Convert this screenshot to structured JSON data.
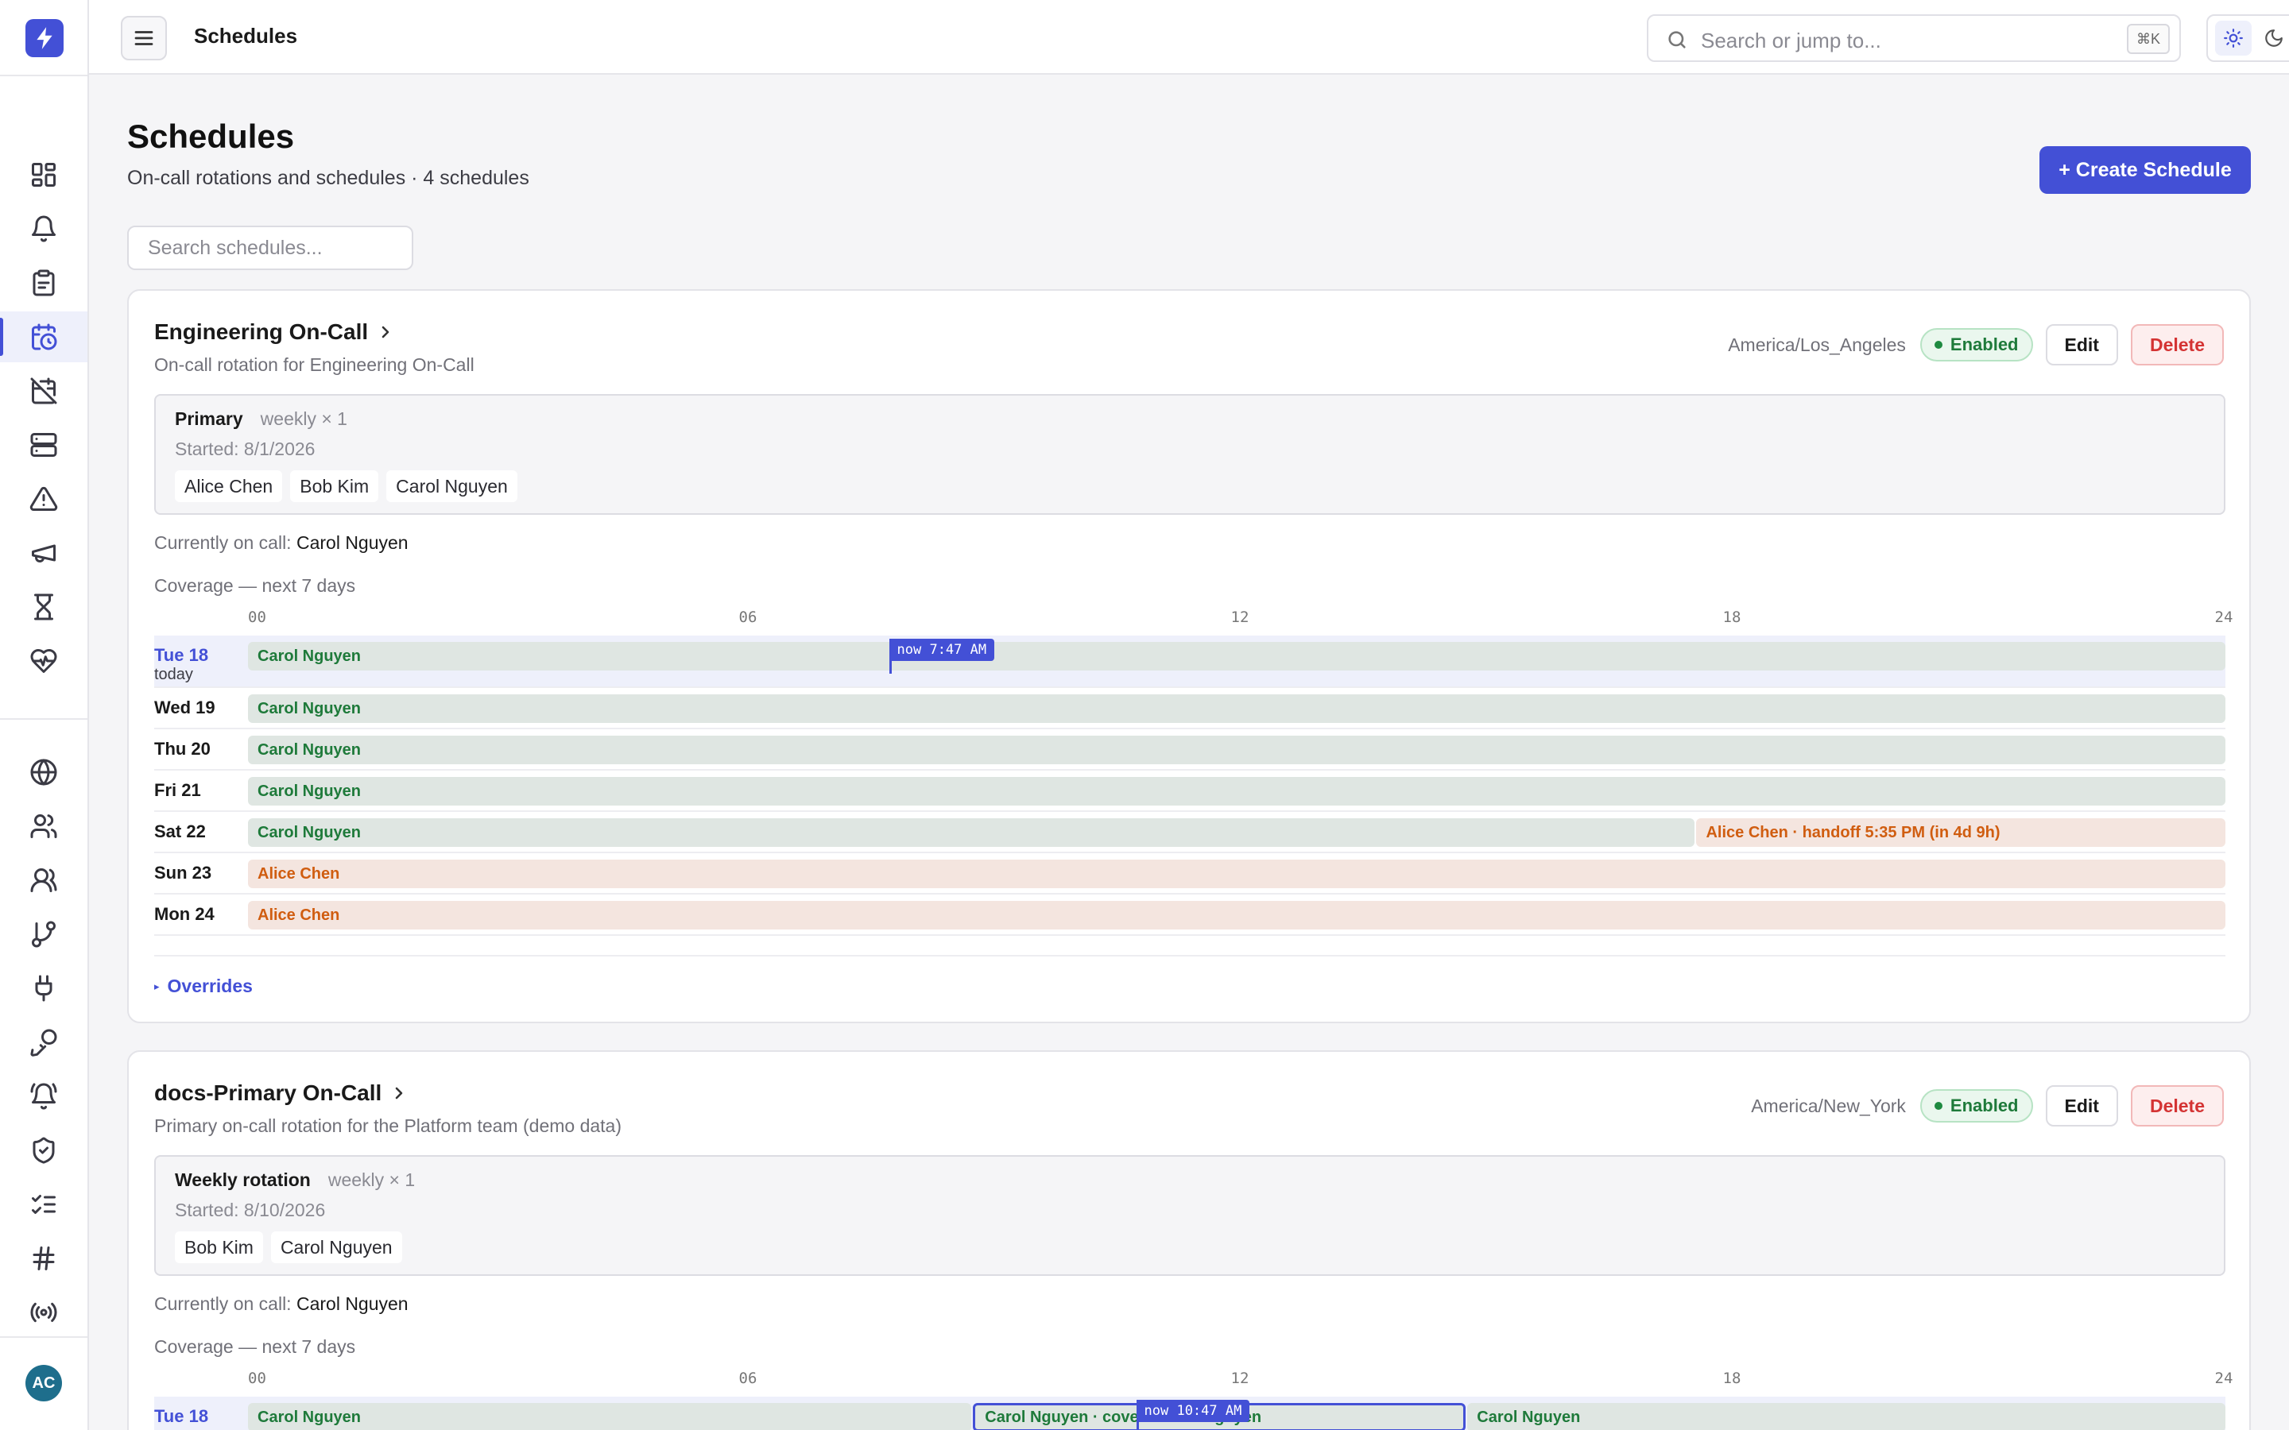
{
  "topbar": {
    "title": "Schedules",
    "search_placeholder": "Search or jump to...",
    "shortcut": "⌘K"
  },
  "sidebar": {
    "items": [
      {
        "icon": "dashboard-icon"
      },
      {
        "icon": "bell-icon"
      },
      {
        "icon": "clipboard-icon"
      },
      {
        "icon": "calendar-clock-icon",
        "active": true
      },
      {
        "icon": "calendar-off-icon"
      },
      {
        "icon": "server-icon"
      },
      {
        "icon": "warning-icon"
      },
      {
        "icon": "megaphone-icon"
      },
      {
        "icon": "hourglass-icon"
      },
      {
        "icon": "heart-pulse-icon"
      },
      {
        "icon": "globe-icon"
      },
      {
        "icon": "users-icon"
      },
      {
        "icon": "team-icon"
      },
      {
        "icon": "git-branch-icon"
      },
      {
        "icon": "plug-icon"
      },
      {
        "icon": "key-icon"
      },
      {
        "icon": "bell-ring-icon"
      },
      {
        "icon": "shield-check-icon"
      },
      {
        "icon": "checklist-icon"
      },
      {
        "icon": "hash-icon"
      },
      {
        "icon": "broadcast-icon"
      }
    ],
    "avatar_initials": "AC"
  },
  "page": {
    "title": "Schedules",
    "subtitle": "On-call rotations and schedules · 4 schedules",
    "create_label": "+ Create Schedule",
    "filter_placeholder": "Search schedules..."
  },
  "labels": {
    "enabled": "Enabled",
    "edit": "Edit",
    "delete": "Delete",
    "currently_on_call": "Currently on call:",
    "coverage": "Coverage — next 7 days",
    "overrides": "Overrides",
    "ticks": [
      "00",
      "06",
      "12",
      "18",
      "24"
    ]
  },
  "schedules": [
    {
      "name": "Engineering On-Call",
      "description": "On-call rotation for Engineering On-Call",
      "timezone": "America/Los_Angeles",
      "rotation": {
        "name": "Primary",
        "frequency": "weekly × 1",
        "started": "Started: 8/1/2026",
        "members": [
          "Alice Chen",
          "Bob Kim",
          "Carol Nguyen"
        ]
      },
      "on_call": "Carol Nguyen",
      "now_label": "now 7:47 AM",
      "days": [
        {
          "label": "Tue 18",
          "sub": "today",
          "today": true,
          "segments": [
            {
              "who": "Carol Nguyen",
              "start": 0,
              "end": 24,
              "color": "green"
            }
          ],
          "now": 7.78
        },
        {
          "label": "Wed 19",
          "segments": [
            {
              "who": "Carol Nguyen",
              "start": 0,
              "end": 24,
              "color": "green"
            }
          ]
        },
        {
          "label": "Thu 20",
          "segments": [
            {
              "who": "Carol Nguyen",
              "start": 0,
              "end": 24,
              "color": "green"
            }
          ]
        },
        {
          "label": "Fri 21",
          "segments": [
            {
              "who": "Carol Nguyen",
              "start": 0,
              "end": 24,
              "color": "green"
            }
          ]
        },
        {
          "label": "Sat 22",
          "segments": [
            {
              "who": "Carol Nguyen",
              "start": 0,
              "end": 17.58,
              "color": "green"
            },
            {
              "who": "Alice Chen · handoff 5:35 PM (in 4d 9h)",
              "start": 17.58,
              "end": 24,
              "color": "orange"
            }
          ]
        },
        {
          "label": "Sun 23",
          "segments": [
            {
              "who": "Alice Chen",
              "start": 0,
              "end": 24,
              "color": "orange"
            }
          ]
        },
        {
          "label": "Mon 24",
          "segments": [
            {
              "who": "Alice Chen",
              "start": 0,
              "end": 24,
              "color": "orange"
            }
          ]
        }
      ]
    },
    {
      "name": "docs-Primary On-Call",
      "description": "Primary on-call rotation for the Platform team (demo data)",
      "timezone": "America/New_York",
      "rotation": {
        "name": "Weekly rotation",
        "frequency": "weekly × 1",
        "started": "Started: 8/10/2026",
        "members": [
          "Bob Kim",
          "Carol Nguyen"
        ]
      },
      "on_call": "Carol Nguyen",
      "now_label": "now 10:47 AM",
      "days": [
        {
          "label": "Tue 18",
          "today": true,
          "segments": [
            {
              "who": "Carol Nguyen",
              "start": 0,
              "end": 8.8,
              "color": "green"
            },
            {
              "who": "Carol Nguyen · covers Carol Nguyen",
              "start": 8.8,
              "end": 14.8,
              "color": "green",
              "override": true
            },
            {
              "who": "Carol Nguyen",
              "start": 14.8,
              "end": 24,
              "color": "green"
            }
          ],
          "now": 10.78
        }
      ]
    }
  ]
}
